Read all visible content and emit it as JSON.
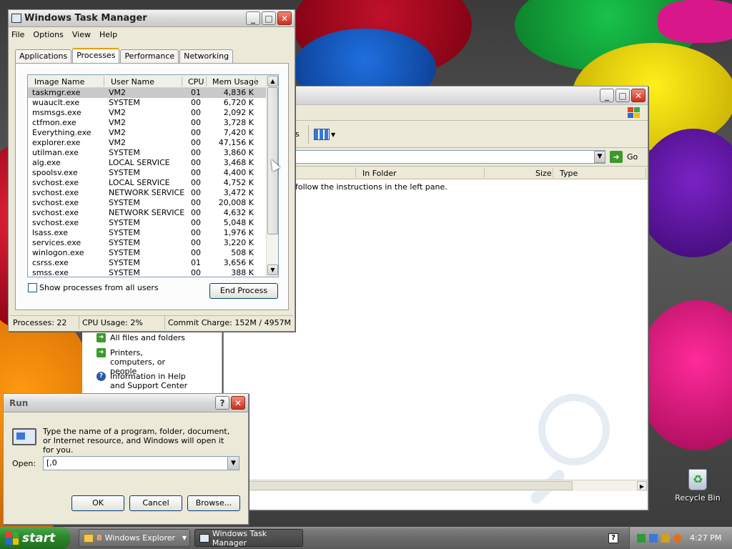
{
  "task_manager": {
    "title": "Windows Task Manager",
    "menu": [
      "File",
      "Options",
      "View",
      "Help"
    ],
    "tabs": [
      "Applications",
      "Processes",
      "Performance",
      "Networking"
    ],
    "active_tab": "Processes",
    "columns": {
      "image": "Image Name",
      "user": "User Name",
      "cpu": "CPU",
      "mem": "Mem Usage"
    },
    "processes": [
      {
        "image": "taskmgr.exe",
        "user": "VM2",
        "cpu": "01",
        "mem": "4,836 K"
      },
      {
        "image": "wuauclt.exe",
        "user": "SYSTEM",
        "cpu": "00",
        "mem": "6,720 K"
      },
      {
        "image": "msmsgs.exe",
        "user": "VM2",
        "cpu": "00",
        "mem": "2,092 K"
      },
      {
        "image": "ctfmon.exe",
        "user": "VM2",
        "cpu": "00",
        "mem": "3,728 K"
      },
      {
        "image": "Everything.exe",
        "user": "VM2",
        "cpu": "00",
        "mem": "7,420 K"
      },
      {
        "image": "explorer.exe",
        "user": "VM2",
        "cpu": "00",
        "mem": "47,156 K"
      },
      {
        "image": "utilman.exe",
        "user": "SYSTEM",
        "cpu": "00",
        "mem": "3,860 K"
      },
      {
        "image": "alg.exe",
        "user": "LOCAL SERVICE",
        "cpu": "00",
        "mem": "3,468 K"
      },
      {
        "image": "spoolsv.exe",
        "user": "SYSTEM",
        "cpu": "00",
        "mem": "4,400 K"
      },
      {
        "image": "svchost.exe",
        "user": "LOCAL SERVICE",
        "cpu": "00",
        "mem": "4,752 K"
      },
      {
        "image": "svchost.exe",
        "user": "NETWORK SERVICE",
        "cpu": "00",
        "mem": "3,472 K"
      },
      {
        "image": "svchost.exe",
        "user": "SYSTEM",
        "cpu": "00",
        "mem": "20,008 K"
      },
      {
        "image": "svchost.exe",
        "user": "NETWORK SERVICE",
        "cpu": "00",
        "mem": "4,632 K"
      },
      {
        "image": "svchost.exe",
        "user": "SYSTEM",
        "cpu": "00",
        "mem": "5,048 K"
      },
      {
        "image": "lsass.exe",
        "user": "SYSTEM",
        "cpu": "00",
        "mem": "1,976 K"
      },
      {
        "image": "services.exe",
        "user": "SYSTEM",
        "cpu": "00",
        "mem": "3,220 K"
      },
      {
        "image": "winlogon.exe",
        "user": "SYSTEM",
        "cpu": "00",
        "mem": "508 K"
      },
      {
        "image": "csrss.exe",
        "user": "SYSTEM",
        "cpu": "01",
        "mem": "3,656 K"
      },
      {
        "image": "smss.exe",
        "user": "SYSTEM",
        "cpu": "00",
        "mem": "388 K"
      }
    ],
    "selected_row": 0,
    "show_all_label": "Show processes from all users",
    "show_all_checked": false,
    "end_process_label": "End Process",
    "status": {
      "processes": "Processes: 22",
      "cpu": "CPU Usage: 2%",
      "commit": "Commit Charge: 152M / 4957M"
    }
  },
  "explorer": {
    "toolbar_text": "s",
    "go_label": "Go",
    "columns": {
      "in_folder": "In Folder",
      "size": "Size",
      "type": "Type"
    },
    "message": "h, follow the instructions in the left pane.",
    "search_pane": {
      "items": [
        {
          "label": "All files and folders",
          "icon": "green-arrow-icon"
        },
        {
          "label": "Printers, computers, or people",
          "icon": "green-arrow-icon"
        },
        {
          "label": "Information in Help and Support Center",
          "icon": "help-icon"
        }
      ]
    }
  },
  "run_dialog": {
    "title": "Run",
    "description": "Type the name of a program, folder, document, or Internet resource, and Windows will open it for you.",
    "open_label": "Open:",
    "open_value": "[,0",
    "ok_label": "OK",
    "cancel_label": "Cancel",
    "browse_label": "Browse..."
  },
  "desktop": {
    "recycle_bin_label": "Recycle Bin"
  },
  "taskbar": {
    "start_label": "start",
    "tasks": [
      {
        "label": "Windows Explorer",
        "count": "8"
      },
      {
        "label": "Windows Task Manager"
      }
    ],
    "clock": "4:27 PM"
  },
  "colors": {
    "selection_gray": "#c9c9c9",
    "start_green": "#2f8a2f",
    "go_green": "#3a9a2a",
    "tab_accent": "#e6a000"
  }
}
